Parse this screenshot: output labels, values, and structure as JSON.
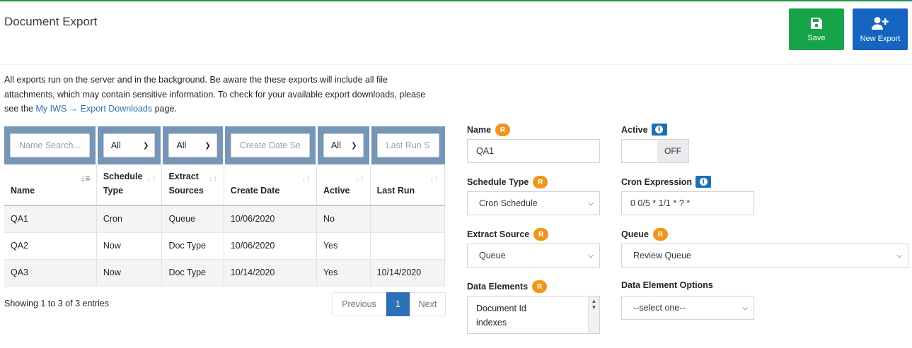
{
  "header": {
    "title": "Document Export",
    "save_label": "Save",
    "new_export_label": "New Export",
    "accent_color": "#1e9a4b",
    "save_color": "#17a34a",
    "new_color": "#1565c0"
  },
  "intro": {
    "text_before": "All exports run on the server and in the background. Be aware the these exports will include all file attachments, which may contain sensitive information. To check for your available export downloads, please see the ",
    "link_text": "My IWS → Export Downloads",
    "text_after": " page."
  },
  "table": {
    "filters": {
      "name_placeholder": "Name Search...",
      "schedule": "All",
      "extract": "All",
      "create_date_placeholder": "Create Date Se",
      "active": "All",
      "last_run_placeholder": "Last Run S"
    },
    "columns": {
      "name": "Name",
      "schedule_type_line1": "Schedule",
      "schedule_type_line2": "Type",
      "extract_sources_line1": "Extract",
      "extract_sources_line2": "Sources",
      "create_date": "Create Date",
      "active": "Active",
      "last_run": "Last Run"
    },
    "rows": [
      {
        "name": "QA1",
        "schedule": "Cron",
        "extract": "Queue",
        "created": "10/06/2020",
        "active": "No",
        "last_run": ""
      },
      {
        "name": "QA2",
        "schedule": "Now",
        "extract": "Doc Type",
        "created": "10/06/2020",
        "active": "Yes",
        "last_run": ""
      },
      {
        "name": "QA3",
        "schedule": "Now",
        "extract": "Doc Type",
        "created": "10/14/2020",
        "active": "Yes",
        "last_run": "10/14/2020"
      }
    ],
    "entries_text": "Showing 1 to 3 of 3 entries",
    "pager": {
      "prev": "Previous",
      "page": "1",
      "next": "Next"
    }
  },
  "form": {
    "required_badge": "R",
    "info_badge": "i",
    "name_label": "Name",
    "name_value": "QA1",
    "active_label": "Active",
    "active_state": "OFF",
    "schedule_type_label": "Schedule Type",
    "schedule_type_value": "Cron Schedule",
    "cron_label": "Cron Expression",
    "cron_value": "0 0/5 * 1/1 * ? *",
    "extract_source_label": "Extract Source",
    "extract_source_value": "Queue",
    "queue_label": "Queue",
    "queue_value": "Review Queue",
    "data_elements_label": "Data Elements",
    "data_elements_options": [
      "Document Id",
      "indexes"
    ],
    "data_element_options_label": "Data Element Options",
    "data_element_options_value": "--select one--"
  }
}
